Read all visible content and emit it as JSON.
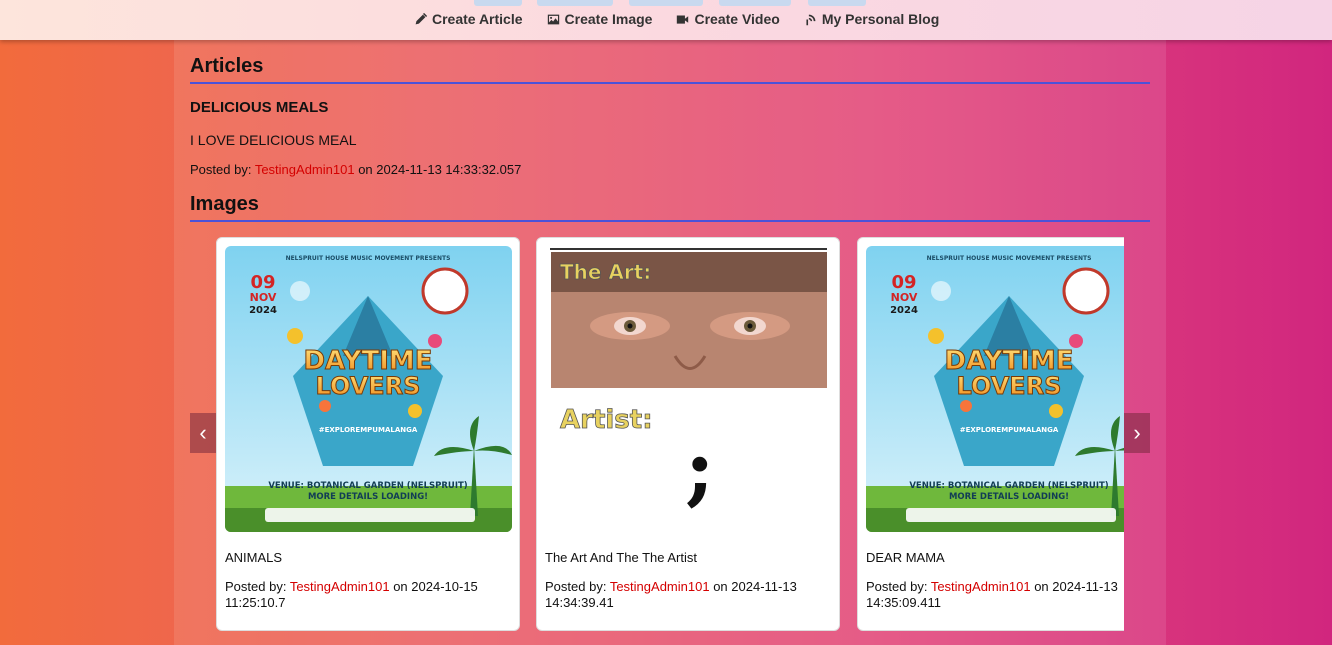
{
  "nav": {
    "items": [
      {
        "label": "Create Article",
        "icon": "pencil-icon"
      },
      {
        "label": "Create Image",
        "icon": "image-icon"
      },
      {
        "label": "Create Video",
        "icon": "video-camera-icon"
      },
      {
        "label": "My Personal Blog",
        "icon": "blog-feed-icon"
      }
    ]
  },
  "articles": {
    "heading": "Articles",
    "items": [
      {
        "title": "DELICIOUS MEALS",
        "body": "I LOVE DELICIOUS MEAL",
        "posted_by_label": "Posted by:",
        "author": "TestingAdmin101",
        "on_label": "on",
        "date": "2024-11-13 14:33:32.057"
      }
    ]
  },
  "images": {
    "heading": "Images",
    "prev_label": "‹",
    "next_label": "›",
    "items": [
      {
        "title": "ANIMALS",
        "posted_by_label": "Posted by:",
        "author": "TestingAdmin101",
        "on_label": "on",
        "date": "2024-10-15 11:25:10.7",
        "poster": {
          "kind": "flyer",
          "top": "NELSPRUIT HOUSE MUSIC MOVEMENT PRESENTS",
          "day": "09",
          "month": "NOV",
          "year": "2024",
          "line1": "DAYTIME",
          "line2": "LOVERS",
          "tag": "#EXPLOREMPUMALANGA",
          "venue": "VENUE: BOTANICAL GARDEN (NELSPRUIT)",
          "more": "MORE DETAILS LOADING!"
        }
      },
      {
        "title": "The Art And The The Artist",
        "posted_by_label": "Posted by:",
        "author": "TestingAdmin101",
        "on_label": "on",
        "date": "2024-11-13 14:34:39.41",
        "poster": {
          "kind": "art",
          "top": "The Art:",
          "bottom": "Artist:",
          "glyph": ";"
        }
      },
      {
        "title": "DEAR MAMA",
        "posted_by_label": "Posted by:",
        "author": "TestingAdmin101",
        "on_label": "on",
        "date": "2024-11-13 14:35:09.411",
        "poster": {
          "kind": "flyer",
          "top": "NELSPRUIT HOUSE MUSIC MOVEMENT PRESENTS",
          "day": "09",
          "month": "NOV",
          "year": "2024",
          "line1": "DAYTIME",
          "line2": "LOVERS",
          "tag": "#EXPLOREMPUMALANGA",
          "venue": "VENUE: BOTANICAL GARDEN (NELSPRUIT)",
          "more": "MORE DETAILS LOADING!"
        }
      }
    ]
  },
  "colors": {
    "accent_line": "#4b52d9",
    "author": "#d40000"
  }
}
